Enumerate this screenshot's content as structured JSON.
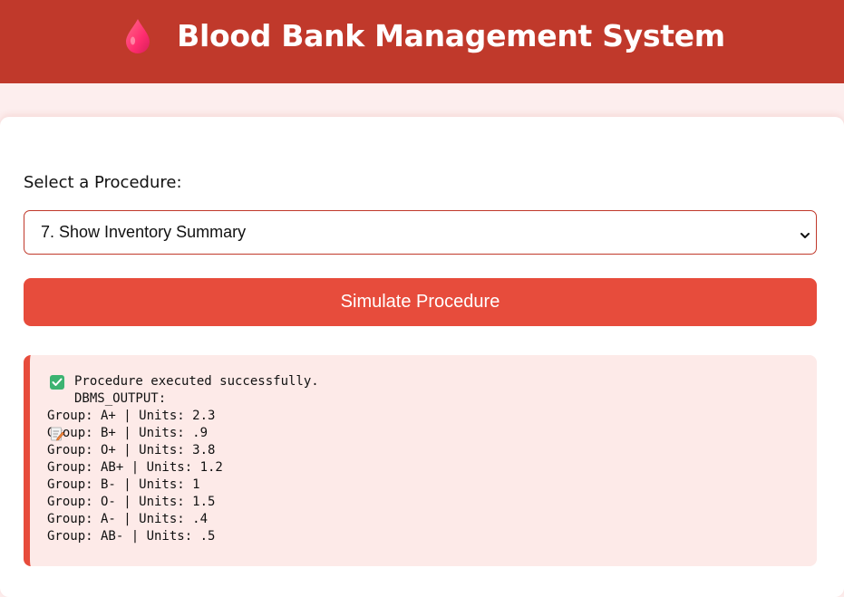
{
  "header": {
    "title": "Blood Bank Management System",
    "icon": "blood-drop-icon"
  },
  "form": {
    "label": "Select a Procedure:",
    "selected_procedure": "7. Show Inventory Summary",
    "button_label": "Simulate Procedure"
  },
  "output": {
    "status": "Procedure executed successfully.",
    "status_icon": "check-mark-icon",
    "dbms_header": "DBMS_OUTPUT:",
    "dbms_icon": "memo-icon",
    "lines": [
      "Group: A+ | Units: 2.3",
      "Group: B+ | Units: .9",
      "Group: O+ | Units: 3.8",
      "Group: AB+ | Units: 1.2",
      "Group: B- | Units: 1",
      "Group: O- | Units: 1.5",
      "Group: A- | Units: .4",
      "Group: AB- | Units: .5"
    ]
  },
  "colors": {
    "header_bg": "#c0392b",
    "accent": "#e74c3c",
    "page_bg": "#fdeeee",
    "output_bg": "#fdeae8"
  }
}
